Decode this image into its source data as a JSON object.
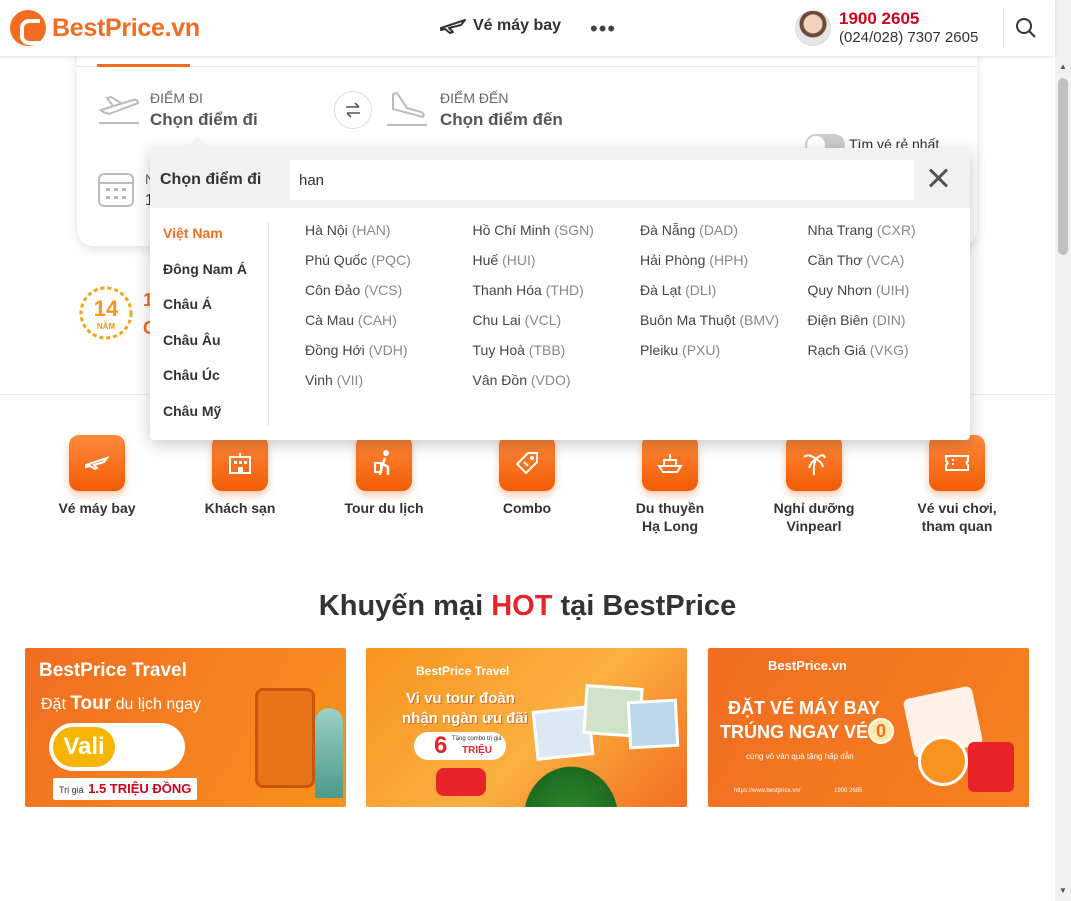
{
  "header": {
    "brand": "BestPrice.vn",
    "nav_flights": "Vé máy bay",
    "nav_more": "•••",
    "hotline": "1900 2605",
    "hotline_sub": "(024/028) 7307 2605"
  },
  "search_form": {
    "from_label": "ĐIỂM ĐI",
    "from_value": "Chọn điểm đi",
    "to_label": "ĐIỂM ĐẾN",
    "to_value": "Chọn điểm đến",
    "cheapest_toggle": "Tìm vé rẻ nhất",
    "date_label": "N",
    "date_value": "1"
  },
  "badge": {
    "years": "14",
    "unit": "NĂM",
    "text_1": "1",
    "text_2": "C"
  },
  "dropdown": {
    "title": "Chọn điểm đi",
    "query": "han",
    "regions": [
      {
        "label": "Việt Nam",
        "active": true
      },
      {
        "label": "Đông Nam Á",
        "active": false
      },
      {
        "label": "Châu Á",
        "active": false
      },
      {
        "label": "Châu Âu",
        "active": false
      },
      {
        "label": "Châu Úc",
        "active": false
      },
      {
        "label": "Châu Mỹ",
        "active": false
      }
    ],
    "cities": [
      {
        "name": "Hà Nội",
        "code": "(HAN)"
      },
      {
        "name": "Hồ Chí Minh",
        "code": "(SGN)"
      },
      {
        "name": "Đà Nẵng",
        "code": "(DAD)"
      },
      {
        "name": "Nha Trang",
        "code": "(CXR)"
      },
      {
        "name": "Phú Quốc",
        "code": "(PQC)"
      },
      {
        "name": "Huế",
        "code": "(HUI)"
      },
      {
        "name": "Hải Phòng",
        "code": "(HPH)"
      },
      {
        "name": "Cần Thơ",
        "code": "(VCA)"
      },
      {
        "name": "Côn Đảo",
        "code": "(VCS)"
      },
      {
        "name": "Thanh Hóa",
        "code": "(THD)"
      },
      {
        "name": "Đà Lạt",
        "code": "(DLI)"
      },
      {
        "name": "Quy Nhơn",
        "code": "(UIH)"
      },
      {
        "name": "Cà Mau",
        "code": "(CAH)"
      },
      {
        "name": "Chu Lai",
        "code": "(VCL)"
      },
      {
        "name": "Buôn Ma Thuột",
        "code": "(BMV)"
      },
      {
        "name": "Điện Biên",
        "code": "(DIN)"
      },
      {
        "name": "Đồng Hới",
        "code": "(VDH)"
      },
      {
        "name": "Tuy Hoà",
        "code": "(TBB)"
      },
      {
        "name": "Pleiku",
        "code": "(PXU)"
      },
      {
        "name": "Rạch Giá",
        "code": "(VKG)"
      },
      {
        "name": "Vinh",
        "code": "(VII)"
      },
      {
        "name": "Vân Đồn",
        "code": "(VDO)"
      }
    ]
  },
  "services": [
    {
      "label": "Vé máy bay",
      "icon": "plane-ticket-icon"
    },
    {
      "label": "Khách sạn",
      "icon": "hotel-icon"
    },
    {
      "label": "Tour du lịch",
      "icon": "traveler-icon"
    },
    {
      "label": "Combo",
      "icon": "combo-tag-icon"
    },
    {
      "label": "Du thuyền\nHạ Long",
      "icon": "cruise-icon"
    },
    {
      "label": "Nghỉ dưỡng\nVinpearl",
      "icon": "resort-icon"
    },
    {
      "label": "Vé vui chơi,\ntham quan",
      "icon": "ticket-icon"
    }
  ],
  "promos": {
    "title_pre": "Khuyến mại ",
    "title_hot": "HOT",
    "title_post": " tại BestPrice",
    "banner_1": {
      "brand": "BestPrice Travel",
      "line_1": "Đặt",
      "line_1_bold": "Tour",
      "line_1_rest": "du lịch ngay",
      "vali": "Vali",
      "vali_sub_1": "Cao cấp",
      "vali_sub_2": "trao tay",
      "price_pre": "Trị giá",
      "price": "1.5 TRIỆU ĐỒNG"
    },
    "banner_2": {
      "brand": "BestPrice Travel",
      "line_1": "Vi vu tour đoàn",
      "line_2": "nhận ngàn ưu đãi",
      "big": "6",
      "small": "Tặng combo trị giá",
      "unit": "TRIỆU"
    },
    "banner_3": {
      "brand": "BestPrice.vn",
      "line_1": "ĐẶT VÉ MÁY BAY",
      "line_2": "TRÚNG NGAY VÉ",
      "zero": "0",
      "sub": "cùng vô vàn quà tặng hấp dẫn",
      "url": "https://www.bestprice.vn/",
      "phone": "1900 2605"
    }
  },
  "colors": {
    "brand_orange": "#f26d21",
    "hot_red": "#e8232a",
    "hotline_red": "#d0021b"
  }
}
